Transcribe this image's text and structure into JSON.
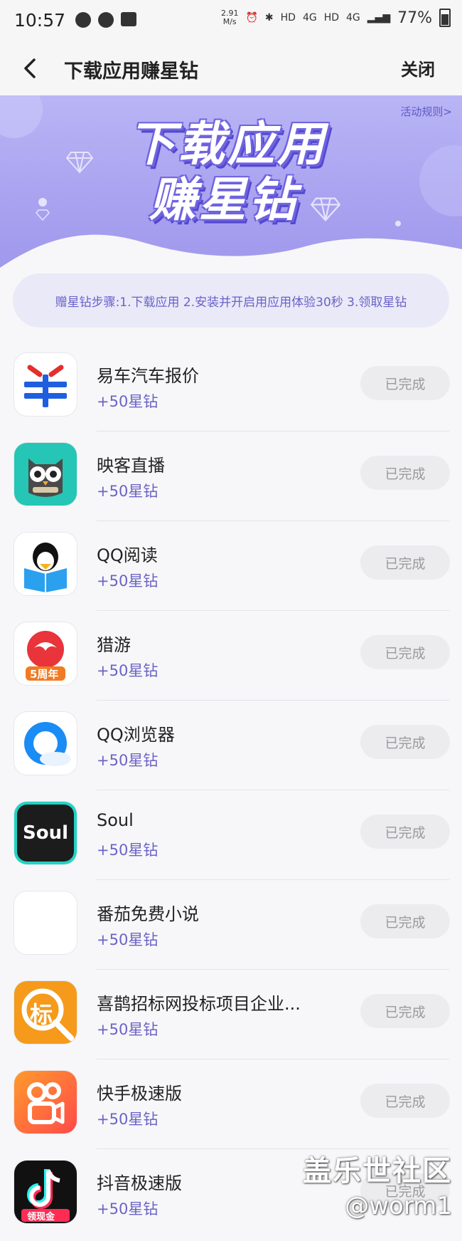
{
  "status_bar": {
    "time": "10:57",
    "net_speed_value": "2.91",
    "net_speed_unit": "M/s",
    "hd1": "HD",
    "net1": "4G",
    "hd2": "HD",
    "net2": "4G",
    "battery": "77%"
  },
  "nav": {
    "title": "下载应用赚星钻",
    "close_label": "关闭"
  },
  "banner": {
    "rules_link": "活动规则>",
    "title_line1": "下载应用",
    "title_line2": "赚星钻"
  },
  "steps_text": "赠星钻步骤:1.下载应用 2.安装并开启用应用体验30秒 3.领取星钻",
  "apps": [
    {
      "name": "易车汽车报价",
      "reward": "+50星钻",
      "button": "已完成",
      "icon": "yiche-icon"
    },
    {
      "name": "映客直播",
      "reward": "+50星钻",
      "button": "已完成",
      "icon": "inke-owl-icon"
    },
    {
      "name": "QQ阅读",
      "reward": "+50星钻",
      "button": "已完成",
      "icon": "qq-reading-icon"
    },
    {
      "name": "猎游",
      "reward": "+50星钻",
      "button": "已完成",
      "icon": "lieyou-icon"
    },
    {
      "name": "QQ浏览器",
      "reward": "+50星钻",
      "button": "已完成",
      "icon": "qq-browser-icon"
    },
    {
      "name": "Soul",
      "reward": "+50星钻",
      "button": "已完成",
      "icon": "soul-icon"
    },
    {
      "name": "番茄免费小说",
      "reward": "+50星钻",
      "button": "已完成",
      "icon": "fanqie-icon"
    },
    {
      "name": "喜鹊招标网投标项目企业...",
      "reward": "+50星钻",
      "button": "已完成",
      "icon": "xique-icon"
    },
    {
      "name": "快手极速版",
      "reward": "+50星钻",
      "button": "已完成",
      "icon": "kuaishou-icon"
    },
    {
      "name": "抖音极速版",
      "reward": "+50星钻",
      "button": "已完成",
      "icon": "douyin-icon"
    }
  ],
  "icon_texts": {
    "lieyou_badge": "5周年",
    "soul_text": "Soul",
    "xique_char": "标",
    "douyin_badge": "领现金"
  },
  "watermark": {
    "line1": "盖乐世社区",
    "line2": "@worm1"
  },
  "colors": {
    "accent_purple": "#6b63c5",
    "banner_top": "#b9b5f5",
    "button_bg": "#ececef"
  }
}
